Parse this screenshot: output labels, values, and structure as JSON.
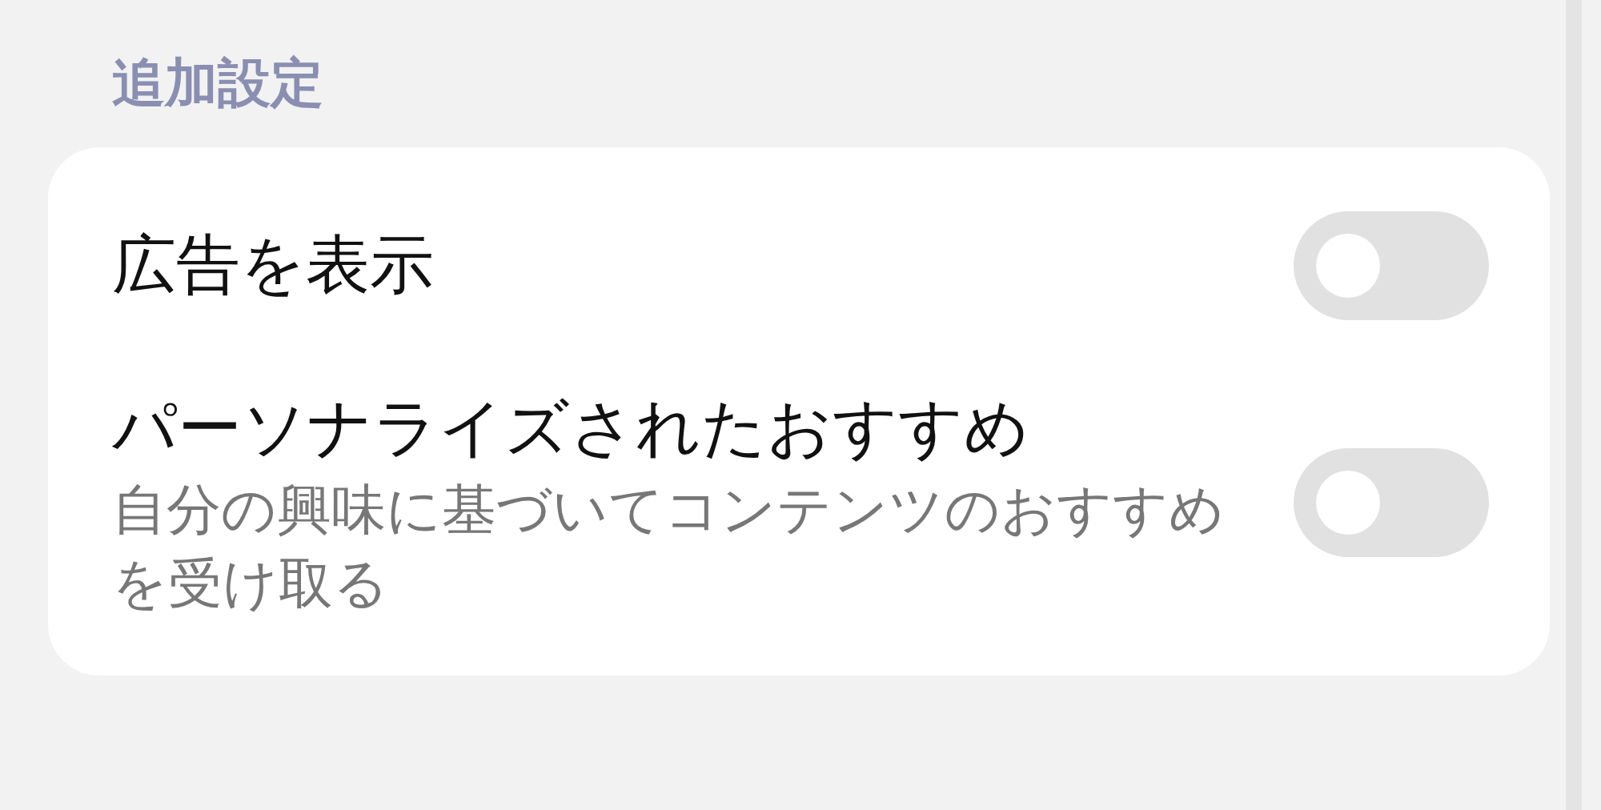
{
  "section_title": "追加設定",
  "rows": [
    {
      "title": "広告を表示",
      "on": false
    },
    {
      "title": "パーソナライズされたおすすめ",
      "description": "自分の興味に基づいてコンテンツのおすすめを受け取る",
      "on": false
    }
  ]
}
